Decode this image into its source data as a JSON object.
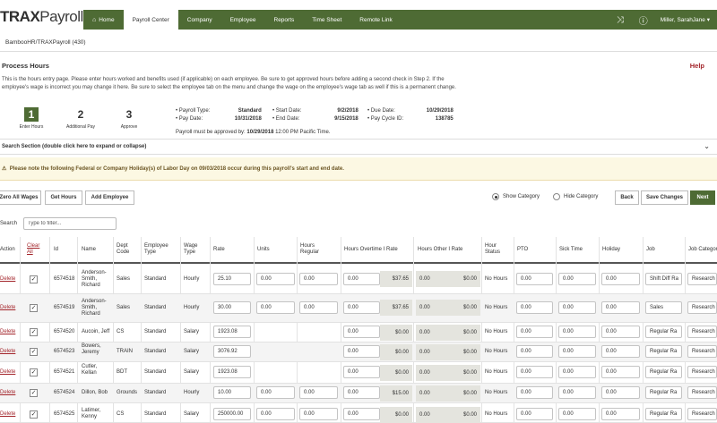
{
  "brand": {
    "prefix": "TRAX",
    "suffix": "Payroll"
  },
  "nav": {
    "items": [
      {
        "label": "Home",
        "icon": "home-icon",
        "active": false
      },
      {
        "label": "Payroll Center",
        "active": true
      },
      {
        "label": "Company",
        "active": false
      },
      {
        "label": "Employee",
        "active": false
      },
      {
        "label": "Reports",
        "active": false
      },
      {
        "label": "Time Sheet",
        "active": false
      },
      {
        "label": "Remote Link",
        "active": false
      }
    ],
    "shuffle_icon": "shuffle-icon",
    "help_icon": "question-circle-icon",
    "user": "Miller, SarahJane",
    "user_caret": "▾"
  },
  "company": "BambooHR/TRAXPayroll (430)",
  "page": {
    "title": "Process Hours",
    "help": "Help",
    "intro": "This is the hours entry page. Please enter hours worked and benefits used (if applicable) on each employee. Be sure to get approved hours before adding a second check in Step 2. If the employee's wage is incorrect you may change it here. Be sure to select the employee tab on the menu and change the wage on the employee's wage tab as well if this is a permanent change."
  },
  "steps": [
    {
      "num": "1",
      "label": "Enter Hours",
      "active": true
    },
    {
      "num": "2",
      "label": "Additional Pay",
      "active": false
    },
    {
      "num": "3",
      "label": "Approve",
      "active": false
    }
  ],
  "payroll_info": {
    "col1": [
      {
        "k": "Payroll Type:",
        "v": "Standard"
      },
      {
        "k": "Pay Date:",
        "v": "10/31/2018"
      }
    ],
    "col2": [
      {
        "k": "Start Date:",
        "v": "9/2/2018"
      },
      {
        "k": "End Date:",
        "v": "9/15/2018"
      }
    ],
    "col3": [
      {
        "k": "Due Date:",
        "v": "10/29/2018"
      },
      {
        "k": "Pay Cycle ID:",
        "v": "138785"
      }
    ],
    "approve_prefix": "Payroll must be approved by:",
    "approve_date": "10/29/2018",
    "approve_suffix": "12:00 PM Pacific Time."
  },
  "search_section": {
    "label": "Search Section (double click here to expand or collapse)",
    "chevron": "⌄"
  },
  "holiday_notice": "Please note the following Federal or Company Holiday(s) of Labor Day on 09/03/2018 occur during this payroll's start and end date.",
  "warning_icon": "warning-icon",
  "toolbar": {
    "zero": "Zero All Wages",
    "get_hours": "Get Hours",
    "add_employee": "Add Employee",
    "show_category": "Show Category",
    "hide_category": "Hide Category",
    "back": "Back",
    "save": "Save Changes",
    "next": "Next"
  },
  "search": {
    "label": "Search",
    "placeholder": "Type to filter..."
  },
  "table": {
    "headers": {
      "action": "Action",
      "clear_all": "Clear All",
      "id": "Id",
      "name": "Name",
      "dept": "Dept Code",
      "emp_type": "Employee Type",
      "wage_type": "Wage Type",
      "rate": "Rate",
      "units": "Units",
      "hours_regular": "Hours Regular",
      "hours_overtime": "Hours Overtime I Rate",
      "hours_other": "Hours Other I Rate",
      "hour_status": "Hour Status",
      "pto": "PTO",
      "sick": "Sick Time",
      "holiday": "Holiday",
      "job": "Job",
      "job_category": "Job Category"
    },
    "rows": [
      {
        "action": "Delete",
        "checked": "✓",
        "id": "6574518",
        "name": "Anderson-Smith, Richard",
        "dept": "Sales",
        "emp_type": "Standard",
        "wage_type": "Hourly",
        "rate": "25.10",
        "units": "0.00",
        "hours_regular": "0.00",
        "ot_hours": "0.00",
        "ot_rate": "$37.65",
        "other_hours": "0.00",
        "other_rate": "$0.00",
        "hour_status": "No Hours",
        "pto": "0.00",
        "sick": "0.00",
        "holiday": "0.00",
        "job": "Shift Diff Ra",
        "job_category": "Research"
      },
      {
        "action": "Delete",
        "checked": "✓",
        "id": "6574519",
        "name": "Anderson-Smith, Richard",
        "dept": "Sales",
        "emp_type": "Standard",
        "wage_type": "Hourly",
        "rate": "30.00",
        "units": "0.00",
        "hours_regular": "0.00",
        "ot_hours": "0.00",
        "ot_rate": "$37.65",
        "other_hours": "0.00",
        "other_rate": "$0.00",
        "hour_status": "No Hours",
        "pto": "0.00",
        "sick": "0.00",
        "holiday": "0.00",
        "job": "Sales",
        "job_category": "Research"
      },
      {
        "action": "Delete",
        "checked": "✓",
        "id": "6574520",
        "name": "Aucoin, Jeff",
        "dept": "CS",
        "emp_type": "Standard",
        "wage_type": "Salary",
        "rate": "1923.08",
        "units": "",
        "hours_regular": "",
        "ot_hours": "0.00",
        "ot_rate": "$0.00",
        "other_hours": "0.00",
        "other_rate": "$0.00",
        "hour_status": "No Hours",
        "pto": "0.00",
        "sick": "0.00",
        "holiday": "0.00",
        "job": "Regular Ra",
        "job_category": "Research"
      },
      {
        "action": "Delete",
        "checked": "✓",
        "id": "6574523",
        "name": "Bowers, Jeremy",
        "dept": "TRAIN",
        "emp_type": "Standard",
        "wage_type": "Salary",
        "rate": "3076.92",
        "units": "",
        "hours_regular": "",
        "ot_hours": "0.00",
        "ot_rate": "$0.00",
        "other_hours": "0.00",
        "other_rate": "$0.00",
        "hour_status": "No Hours",
        "pto": "0.00",
        "sick": "0.00",
        "holiday": "0.00",
        "job": "Regular Ra",
        "job_category": "Research"
      },
      {
        "action": "Delete",
        "checked": "✓",
        "id": "6574521",
        "name": "Cutler, Kellan",
        "dept": "BDT",
        "emp_type": "Standard",
        "wage_type": "Salary",
        "rate": "1923.08",
        "units": "",
        "hours_regular": "",
        "ot_hours": "0.00",
        "ot_rate": "$0.00",
        "other_hours": "0.00",
        "other_rate": "$0.00",
        "hour_status": "No Hours",
        "pto": "0.00",
        "sick": "0.00",
        "holiday": "0.00",
        "job": "Regular Ra",
        "job_category": "Research"
      },
      {
        "action": "Delete",
        "checked": "✓",
        "id": "6574524",
        "name": "Dillon, Bob",
        "dept": "Grounds",
        "emp_type": "Standard",
        "wage_type": "Hourly",
        "rate": "10.00",
        "units": "0.00",
        "hours_regular": "0.00",
        "ot_hours": "0.00",
        "ot_rate": "$15.00",
        "other_hours": "0.00",
        "other_rate": "$0.00",
        "hour_status": "No Hours",
        "pto": "0.00",
        "sick": "0.00",
        "holiday": "0.00",
        "job": "Regular Ra",
        "job_category": "Research"
      },
      {
        "action": "Delete",
        "checked": "✓",
        "id": "6574525",
        "name": "Latimer, Kenny",
        "dept": "CS",
        "emp_type": "Standard",
        "wage_type": "Salary",
        "rate": "250000.00",
        "units": "0.00",
        "hours_regular": "0.00",
        "ot_hours": "0.00",
        "ot_rate": "$0.00",
        "other_hours": "0.00",
        "other_rate": "$0.00",
        "hour_status": "No Hours",
        "pto": "0.00",
        "sick": "0.00",
        "holiday": "0.00",
        "job": "Regular Ra",
        "job_category": "Research"
      }
    ]
  }
}
